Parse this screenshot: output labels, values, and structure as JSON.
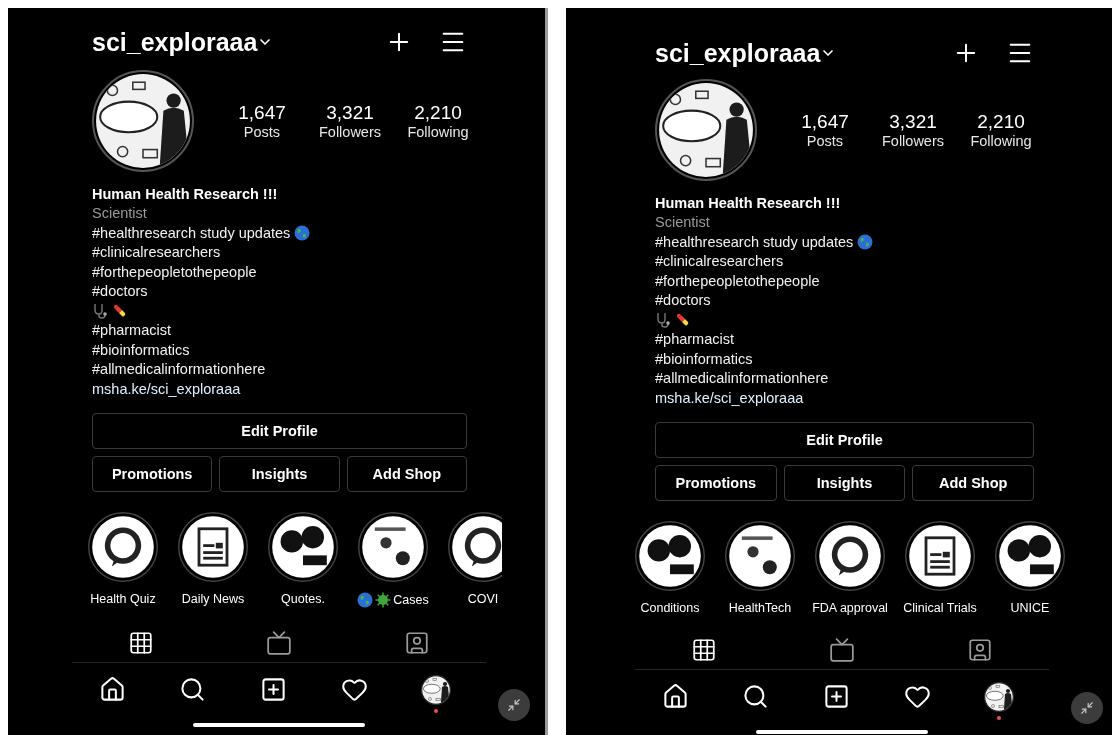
{
  "screens": [
    {
      "username": "sci_exploraaa",
      "stats": [
        {
          "value": "1,647",
          "label": "Posts"
        },
        {
          "value": "3,321",
          "label": "Followers"
        },
        {
          "value": "2,210",
          "label": "Following"
        }
      ],
      "bio": {
        "name": "Human Health Research !!!",
        "category": "Scientist",
        "lines": [
          {
            "kind": "globe",
            "text": "#healthresearch study updates"
          },
          {
            "kind": "plain",
            "text": "#clinicalresearchers"
          },
          {
            "kind": "plain",
            "text": "#forthepeopletothepeople"
          },
          {
            "kind": "plain",
            "text": "#doctors"
          },
          {
            "kind": "emoji"
          },
          {
            "kind": "plain",
            "text": "#pharmacist"
          },
          {
            "kind": "plain",
            "text": "#bioinformatics"
          },
          {
            "kind": "plain",
            "text": "#allmedicalinformationhere"
          },
          {
            "kind": "link",
            "text": "msha.ke/sci_exploraaa"
          }
        ]
      },
      "edit_button": "Edit Profile",
      "buttons": [
        "Promotions",
        "Insights",
        "Add Shop"
      ],
      "highlights": [
        {
          "kind": "plain",
          "label": "Health Quiz"
        },
        {
          "kind": "plain",
          "label": "Daily News"
        },
        {
          "kind": "plain",
          "label": "Quotes."
        },
        {
          "kind": "globe-virus",
          "label": "Cases"
        },
        {
          "kind": "plain",
          "label": "COVI"
        }
      ],
      "tabs": [
        {
          "selected": true
        },
        {
          "selected": false
        },
        {
          "selected": false
        }
      ],
      "notification": true
    },
    {
      "username": "sci_exploraaa",
      "stats": [
        {
          "value": "1,647",
          "label": "Posts"
        },
        {
          "value": "3,321",
          "label": "Followers"
        },
        {
          "value": "2,210",
          "label": "Following"
        }
      ],
      "bio": {
        "name": "Human Health Research !!!",
        "category": "Scientist",
        "lines": [
          {
            "kind": "globe",
            "text": "#healthresearch study updates"
          },
          {
            "kind": "plain",
            "text": "#clinicalresearchers"
          },
          {
            "kind": "plain",
            "text": "#forthepeopletothepeople"
          },
          {
            "kind": "plain",
            "text": "#doctors"
          },
          {
            "kind": "emoji"
          },
          {
            "kind": "plain",
            "text": "#pharmacist"
          },
          {
            "kind": "plain",
            "text": "#bioinformatics"
          },
          {
            "kind": "plain",
            "text": "#allmedicalinformationhere"
          },
          {
            "kind": "link",
            "text": "msha.ke/sci_exploraaa"
          }
        ]
      },
      "edit_button": "Edit Profile",
      "buttons": [
        "Promotions",
        "Insights",
        "Add Shop"
      ],
      "highlights": [
        {
          "kind": "plain",
          "label": "Conditions"
        },
        {
          "kind": "plain",
          "label": "HealthTech"
        },
        {
          "kind": "plain",
          "label": "FDA approval"
        },
        {
          "kind": "plain",
          "label": "Clinical Trials"
        },
        {
          "kind": "plain",
          "label": "UNICE"
        }
      ],
      "tabs": [
        {
          "selected": true
        },
        {
          "selected": false
        },
        {
          "selected": false
        }
      ],
      "notification": true
    }
  ]
}
